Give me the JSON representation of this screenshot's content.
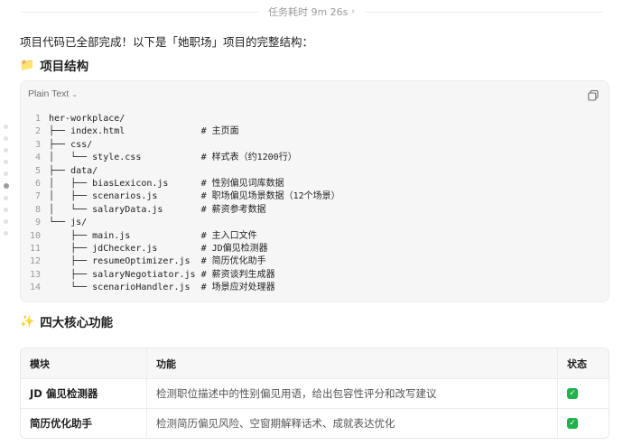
{
  "topbar": {
    "task_time_label": "任务耗时 9m 26s"
  },
  "intro": "项目代码已全部完成！以下是「她职场」项目的完整结构：",
  "section1": {
    "emoji": "📁",
    "title": "项目结构"
  },
  "codeblock": {
    "language": "Plain Text",
    "lines": [
      {
        "n": "1",
        "text": "her-workplace/"
      },
      {
        "n": "2",
        "text": "├── index.html              # 主页面"
      },
      {
        "n": "3",
        "text": "├── css/"
      },
      {
        "n": "4",
        "text": "│   └── style.css           # 样式表（约1200行）"
      },
      {
        "n": "5",
        "text": "├── data/"
      },
      {
        "n": "6",
        "text": "│   ├── biasLexicon.js      # 性别偏见词库数据"
      },
      {
        "n": "7",
        "text": "│   ├── scenarios.js        # 职场偏见场景数据（12个场景）"
      },
      {
        "n": "8",
        "text": "│   └── salaryData.js       # 薪资参考数据"
      },
      {
        "n": "9",
        "text": "└── js/"
      },
      {
        "n": "10",
        "text": "    ├── main.js             # 主入口文件"
      },
      {
        "n": "11",
        "text": "    ├── jdChecker.js        # JD偏见检测器"
      },
      {
        "n": "12",
        "text": "    ├── resumeOptimizer.js  # 简历优化助手"
      },
      {
        "n": "13",
        "text": "    ├── salaryNegotiator.js # 薪资谈判生成器"
      },
      {
        "n": "14",
        "text": "    └── scenarioHandler.js  # 场景应对处理器"
      }
    ]
  },
  "section2": {
    "emoji": "✨",
    "title": "四大核心功能"
  },
  "table": {
    "headers": {
      "module": "模块",
      "feature": "功能",
      "status": "状态"
    },
    "rows": [
      {
        "module": "JD 偏见检测器",
        "feature": "检测职位描述中的性别偏见用语，给出包容性评分和改写建议",
        "status": "✓"
      },
      {
        "module": "简历优化助手",
        "feature": "检测简历偏见风险、空窗期解释话术、成就表达优化",
        "status": "✓"
      }
    ]
  },
  "colors": {
    "code_bg": "#f6f6f7",
    "check_green": "#22b04b"
  }
}
